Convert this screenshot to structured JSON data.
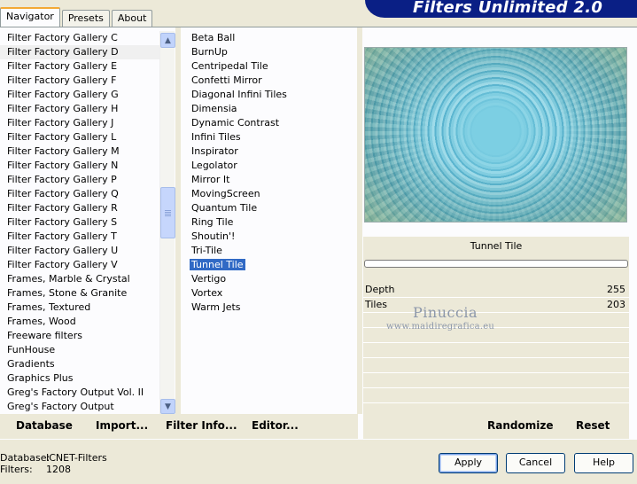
{
  "app": {
    "title": "Filters Unlimited 2.0"
  },
  "tabs": [
    {
      "label": "Navigator",
      "active": true
    },
    {
      "label": "Presets",
      "active": false
    },
    {
      "label": "About",
      "active": false
    }
  ],
  "categories": [
    "Filter Factory Gallery C",
    "Filter Factory Gallery D",
    "Filter Factory Gallery E",
    "Filter Factory Gallery F",
    "Filter Factory Gallery G",
    "Filter Factory Gallery H",
    "Filter Factory Gallery J",
    "Filter Factory Gallery L",
    "Filter Factory Gallery M",
    "Filter Factory Gallery N",
    "Filter Factory Gallery P",
    "Filter Factory Gallery Q",
    "Filter Factory Gallery R",
    "Filter Factory Gallery S",
    "Filter Factory Gallery T",
    "Filter Factory Gallery U",
    "Filter Factory Gallery V",
    "Frames, Marble & Crystal",
    "Frames, Stone & Granite",
    "Frames, Textured",
    "Frames, Wood",
    "Freeware filters",
    "FunHouse",
    "Gradients",
    "Graphics Plus",
    "Greg's Factory Output Vol. II",
    "Greg's Factory Output"
  ],
  "selected_category_index": 1,
  "filters": [
    "Beta Ball",
    "BurnUp",
    "Centripedal Tile",
    "Confetti Mirror",
    "Diagonal Infini Tiles",
    "Dimensia",
    "Dynamic Contrast",
    "Infini Tiles",
    "Inspirator",
    "Legolator",
    "Mirror It",
    "MovingScreen",
    "Quantum Tile",
    "Ring Tile",
    "Shoutin'!",
    "Tri-Tile",
    "Tunnel Tile",
    "Vertigo",
    "Vortex",
    "Warm Jets"
  ],
  "selected_filter_index": 16,
  "preview": {
    "filter_name": "Tunnel Tile",
    "params": [
      {
        "label": "Depth",
        "value": "255"
      },
      {
        "label": "Tiles",
        "value": "203"
      }
    ],
    "randomize_label": "Randomize",
    "reset_label": "Reset"
  },
  "watermark": {
    "name": "Pinuccia",
    "site": "www.maidiregrafica.eu"
  },
  "left_buttons": {
    "database": "Database",
    "import": "Import...",
    "filter_info": "Filter Info...",
    "editor": "Editor..."
  },
  "status": {
    "database_label": "Database:",
    "database_value": "ICNET-Filters",
    "filters_label": "Filters:",
    "filters_value": "1208"
  },
  "dialog_buttons": {
    "apply": "Apply",
    "cancel": "Cancel",
    "help": "Help"
  }
}
